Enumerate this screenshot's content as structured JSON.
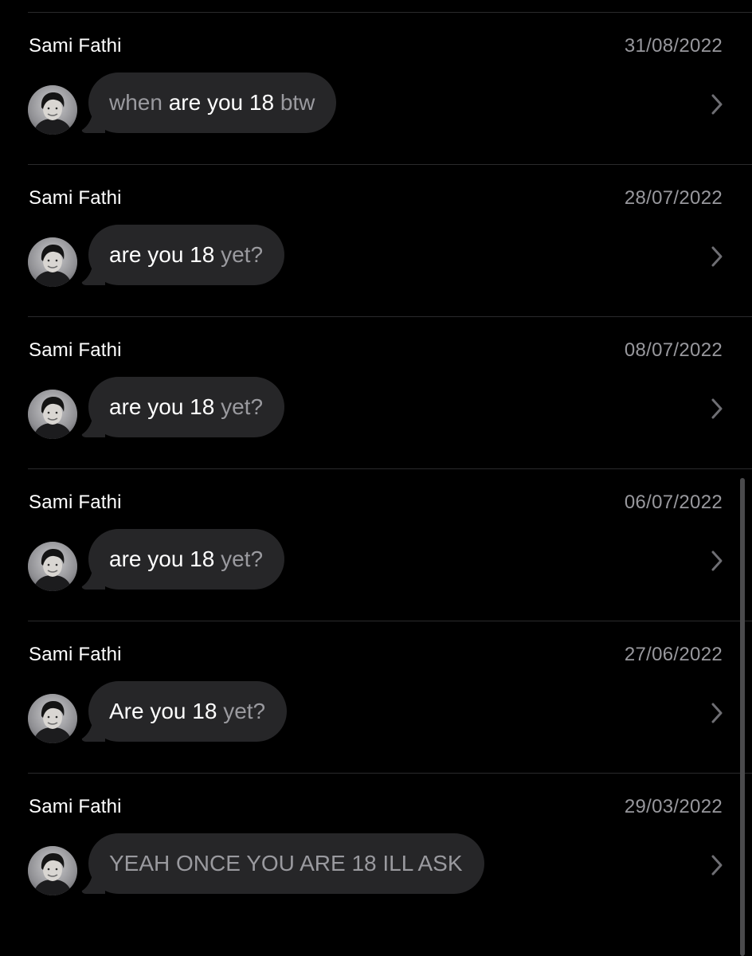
{
  "results": [
    {
      "sender": "Sami Fathi",
      "date": "31/08/2022",
      "message": [
        {
          "text": "when ",
          "style": "dim"
        },
        {
          "text": "are you 18",
          "style": "hl"
        },
        {
          "text": " btw",
          "style": "dim"
        }
      ]
    },
    {
      "sender": "Sami Fathi",
      "date": "28/07/2022",
      "message": [
        {
          "text": "are you 18",
          "style": "hl"
        },
        {
          "text": " yet?",
          "style": "dim"
        }
      ]
    },
    {
      "sender": "Sami Fathi",
      "date": "08/07/2022",
      "message": [
        {
          "text": "are you 18",
          "style": "hl"
        },
        {
          "text": " yet?",
          "style": "dim"
        }
      ]
    },
    {
      "sender": "Sami Fathi",
      "date": "06/07/2022",
      "message": [
        {
          "text": "are you 18",
          "style": "hl"
        },
        {
          "text": " yet?",
          "style": "dim"
        }
      ]
    },
    {
      "sender": "Sami Fathi",
      "date": "27/06/2022",
      "message": [
        {
          "text": "Are you 18",
          "style": "hl"
        },
        {
          "text": " yet?",
          "style": "dim"
        }
      ]
    },
    {
      "sender": "Sami Fathi",
      "date": "29/03/2022",
      "message": [
        {
          "text": "YEAH ONCE YOU ARE 18 ILL ASK",
          "style": "dim"
        }
      ]
    }
  ],
  "icons": {
    "avatar": "contact-avatar-photo",
    "disclosure": "chevron-right-icon"
  },
  "colors": {
    "background": "#000000",
    "bubble": "#262628",
    "highlight_text": "#ffffff",
    "dim_text": "#9a9a9f",
    "date_text": "#98989d",
    "divider": "#2a2a2c"
  }
}
